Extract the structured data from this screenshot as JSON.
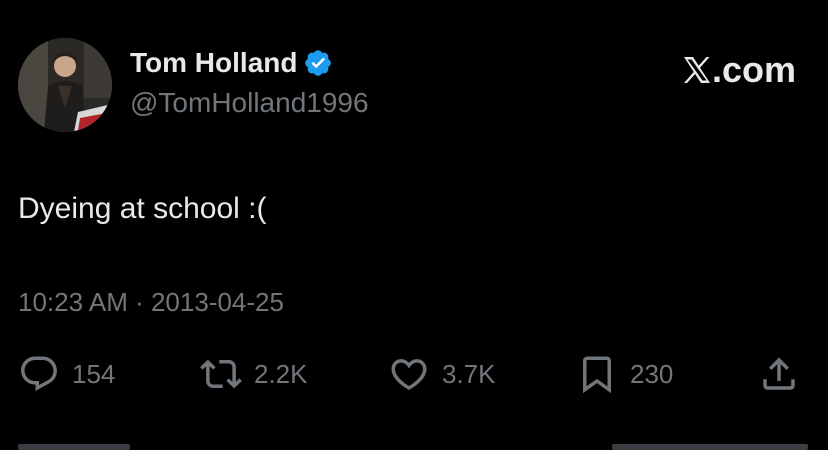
{
  "author": {
    "display_name": "Tom Holland",
    "handle": "@TomHolland1996",
    "verified": true,
    "avatar_icon": "profile-photo"
  },
  "brand": {
    "label": ".com",
    "logo_icon": "x-logo-icon"
  },
  "tweet": {
    "text": "Dyeing at school :(",
    "meta": "10:23 AM · 2013-04-25"
  },
  "actions": {
    "replies": "154",
    "retweets": "2.2K",
    "likes": "3.7K",
    "bookmarks": "230"
  },
  "colors": {
    "background": "#000000",
    "primary_text": "#e7e9ea",
    "secondary_text": "#71767b",
    "verified_blue": "#1d9bf0"
  }
}
